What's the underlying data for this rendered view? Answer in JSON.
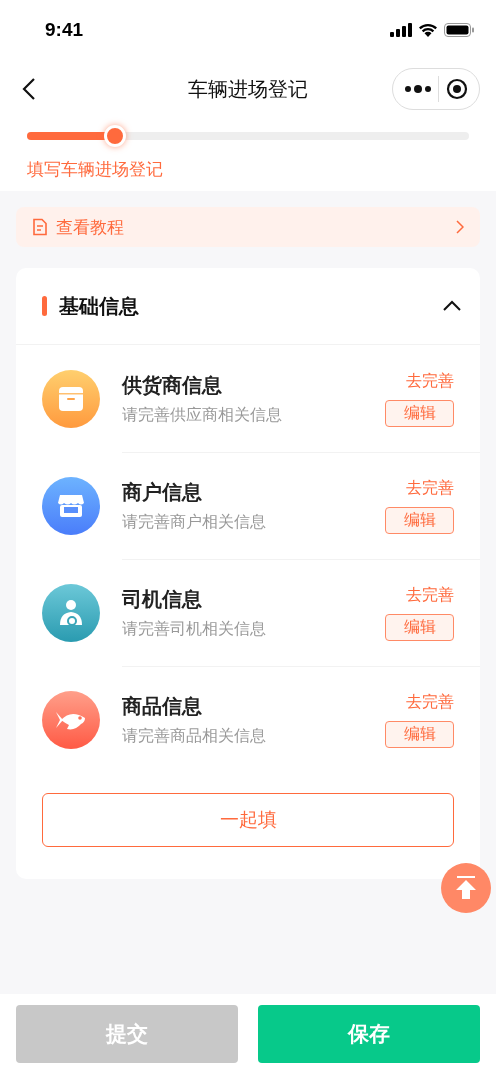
{
  "status_bar": {
    "time": "9:41"
  },
  "nav": {
    "title": "车辆进场登记"
  },
  "progress": {
    "level": 0.2,
    "label": "填写车辆进场登记"
  },
  "tutorial": {
    "label": "查看教程"
  },
  "section": {
    "title": "基础信息",
    "expanded": true,
    "items": [
      {
        "kind": "box",
        "title": "供货商信息",
        "subtitle": "请完善供应商相关信息",
        "status": "去完善",
        "action": "编辑"
      },
      {
        "kind": "shop",
        "title": "商户信息",
        "subtitle": "请完善商户相关信息",
        "status": "去完善",
        "action": "编辑"
      },
      {
        "kind": "driver",
        "title": "司机信息",
        "subtitle": "请完善司机相关信息",
        "status": "去完善",
        "action": "编辑"
      },
      {
        "kind": "fish",
        "title": "商品信息",
        "subtitle": "请完善商品相关信息",
        "status": "去完善",
        "action": "编辑"
      }
    ],
    "fill_all": "一起填"
  },
  "footer": [
    {
      "label": "提交",
      "kind": "secondary",
      "disabled": true
    },
    {
      "label": "保存",
      "kind": "primary",
      "disabled": false
    }
  ]
}
